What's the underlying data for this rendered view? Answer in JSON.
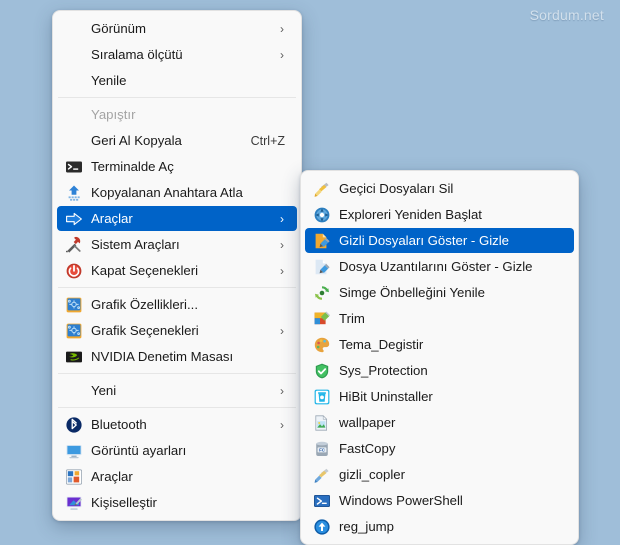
{
  "watermark": "Sordum.net",
  "colors": {
    "desktop_background": "#9fbed9",
    "menu_background": "#f9f9f9",
    "highlight": "#0063c8",
    "text": "#1a1a1a",
    "disabled_text": "#a4a4a4",
    "watermark_text": "#d2e0ec"
  },
  "context_menu": {
    "name": "desktop-context-menu",
    "items": [
      {
        "label": "Görünüm",
        "icon": "none",
        "arrow": "›",
        "accel": "",
        "state": "normal"
      },
      {
        "label": "Sıralama ölçütü",
        "icon": "none",
        "arrow": "›",
        "accel": "",
        "state": "normal"
      },
      {
        "label": "Yenile",
        "icon": "none",
        "arrow": "",
        "accel": "",
        "state": "normal"
      },
      {
        "label": "",
        "icon": "",
        "arrow": "",
        "accel": "",
        "state": "separator"
      },
      {
        "label": "Yapıştır",
        "icon": "none",
        "arrow": "",
        "accel": "",
        "state": "disabled"
      },
      {
        "label": "Geri Al Kopyala",
        "icon": "none",
        "arrow": "",
        "accel": "Ctrl+Z",
        "state": "normal"
      },
      {
        "label": "Terminalde Aç",
        "icon": "terminal-icon",
        "arrow": "",
        "accel": "",
        "state": "normal"
      },
      {
        "label": "Kopyalanan Anahtara Atla",
        "icon": "blue-up-arrow-icon",
        "arrow": "",
        "accel": "",
        "state": "normal"
      },
      {
        "label": "Araçlar",
        "icon": "blue-right-arrow-icon",
        "arrow": "›",
        "accel": "",
        "state": "selected"
      },
      {
        "label": "Sistem Araçları",
        "icon": "hammer-wrench-icon",
        "arrow": "›",
        "accel": "",
        "state": "normal"
      },
      {
        "label": "Kapat Seçenekleri",
        "icon": "power-icon",
        "arrow": "›",
        "accel": "",
        "state": "normal"
      },
      {
        "label": "",
        "icon": "",
        "arrow": "",
        "accel": "",
        "state": "separator"
      },
      {
        "label": "Grafik Özellikleri...",
        "icon": "graphics-properties-icon",
        "arrow": "",
        "accel": "",
        "state": "normal"
      },
      {
        "label": "Grafik Seçenekleri",
        "icon": "graphics-properties-icon",
        "arrow": "›",
        "accel": "",
        "state": "normal"
      },
      {
        "label": "NVIDIA Denetim Masası",
        "icon": "nvidia-icon",
        "arrow": "",
        "accel": "",
        "state": "normal"
      },
      {
        "label": "",
        "icon": "",
        "arrow": "",
        "accel": "",
        "state": "separator"
      },
      {
        "label": "Yeni",
        "icon": "none",
        "arrow": "›",
        "accel": "",
        "state": "normal"
      },
      {
        "label": "",
        "icon": "",
        "arrow": "",
        "accel": "",
        "state": "separator"
      },
      {
        "label": "Bluetooth",
        "icon": "bluetooth-icon",
        "arrow": "›",
        "accel": "",
        "state": "normal"
      },
      {
        "label": "Görüntü ayarları",
        "icon": "monitor-icon",
        "arrow": "",
        "accel": "",
        "state": "normal"
      },
      {
        "label": "Araçlar",
        "icon": "tools-blocks-icon",
        "arrow": "",
        "accel": "",
        "state": "normal"
      },
      {
        "label": "Kişiselleştir",
        "icon": "personalize-icon",
        "arrow": "",
        "accel": "",
        "state": "normal"
      }
    ]
  },
  "sub_menu": {
    "name": "araclar-submenu",
    "items": [
      {
        "label": "Geçici Dosyaları Sil",
        "icon": "broom-yellow-icon",
        "state": "normal"
      },
      {
        "label": "Exploreri Yeniden Başlat",
        "icon": "explorer-restart-icon",
        "state": "normal"
      },
      {
        "label": "Gizli Dosyaları Göster - Gizle",
        "icon": "hidden-files-icon",
        "state": "selected"
      },
      {
        "label": "Dosya Uzantılarını Göster - Gizle",
        "icon": "file-extensions-icon",
        "state": "normal"
      },
      {
        "label": "Simge Önbelleğini Yenile",
        "icon": "refresh-green-icon",
        "state": "normal"
      },
      {
        "label": "Trim",
        "icon": "trim-chart-icon",
        "state": "normal"
      },
      {
        "label": "Tema_Degistir",
        "icon": "palette-icon",
        "state": "normal"
      },
      {
        "label": "Sys_Protection",
        "icon": "green-shield-icon",
        "state": "normal"
      },
      {
        "label": "HiBit Uninstaller",
        "icon": "hibit-uninstaller-icon",
        "state": "normal"
      },
      {
        "label": "wallpaper",
        "icon": "picture-icon",
        "state": "normal"
      },
      {
        "label": "FastCopy",
        "icon": "fastcopy-icon",
        "state": "normal"
      },
      {
        "label": "gizli_copler",
        "icon": "broom-blue-icon",
        "state": "normal"
      },
      {
        "label": "Windows PowerShell",
        "icon": "powershell-icon",
        "state": "normal"
      },
      {
        "label": "reg_jump",
        "icon": "reg-jump-icon",
        "state": "normal"
      }
    ]
  }
}
